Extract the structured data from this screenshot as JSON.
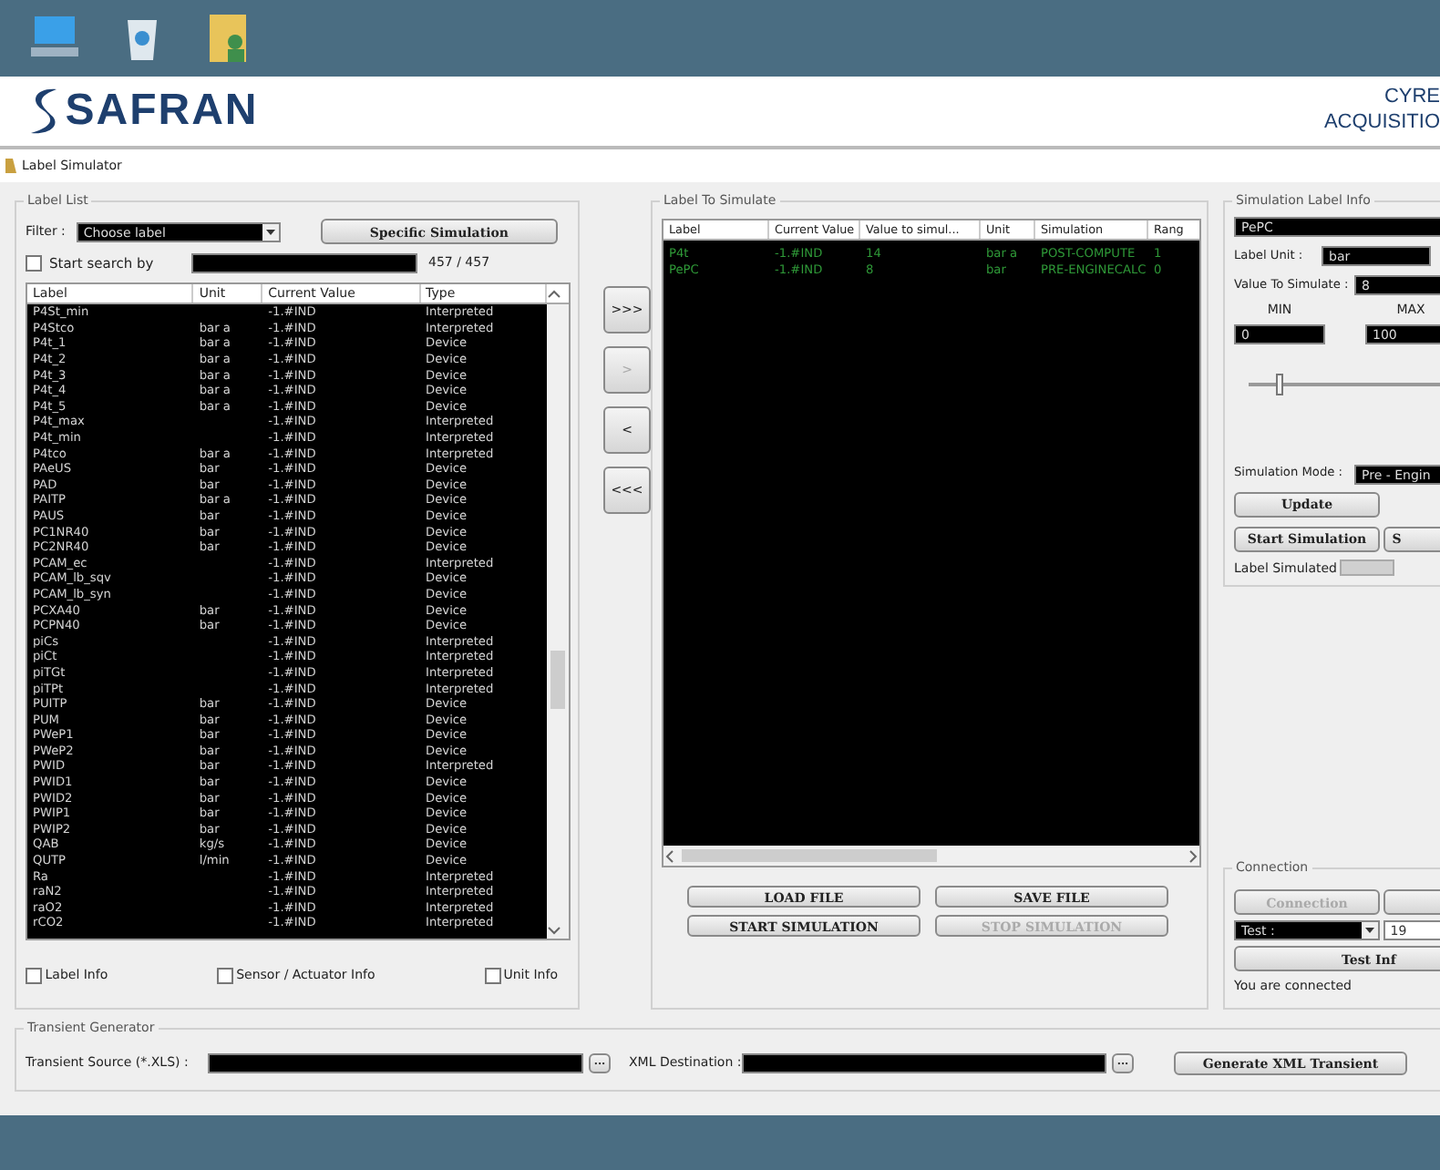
{
  "desktop_icons": [
    {
      "kind": "computer"
    },
    {
      "kind": "recycle-bin"
    },
    {
      "kind": "folder"
    }
  ],
  "header": {
    "logo": "SAFRAN",
    "right_text": [
      "CYRE",
      "ACQUISITIO"
    ]
  },
  "window": {
    "title": "Label Simulator"
  },
  "label_list": {
    "title": "Label List",
    "filter_label": "Filter :",
    "filter_value": "Choose label",
    "specific_button": "Specific Simulation",
    "search": {
      "label": "Start search by",
      "checked": false
    },
    "count": "457 / 457",
    "columns": [
      "Label",
      "Unit",
      "Current Value",
      "Type"
    ],
    "rows": [
      [
        "P4St_min",
        "",
        "-1.#IND",
        "Interpreted"
      ],
      [
        "P4Stco",
        "bar a",
        "-1.#IND",
        "Interpreted"
      ],
      [
        "P4t_1",
        "bar a",
        "-1.#IND",
        "Device"
      ],
      [
        "P4t_2",
        "bar a",
        "-1.#IND",
        "Device"
      ],
      [
        "P4t_3",
        "bar a",
        "-1.#IND",
        "Device"
      ],
      [
        "P4t_4",
        "bar a",
        "-1.#IND",
        "Device"
      ],
      [
        "P4t_5",
        "bar a",
        "-1.#IND",
        "Device"
      ],
      [
        "P4t_max",
        "",
        "-1.#IND",
        "Interpreted"
      ],
      [
        "P4t_min",
        "",
        "-1.#IND",
        "Interpreted"
      ],
      [
        "P4tco",
        "bar a",
        "-1.#IND",
        "Interpreted"
      ],
      [
        "PAeUS",
        "bar",
        "-1.#IND",
        "Device"
      ],
      [
        "PAD",
        "bar",
        "-1.#IND",
        "Device"
      ],
      [
        "PAITP",
        "bar a",
        "-1.#IND",
        "Device"
      ],
      [
        "PAUS",
        "bar",
        "-1.#IND",
        "Device"
      ],
      [
        "PC1NR40",
        "bar",
        "-1.#IND",
        "Device"
      ],
      [
        "PC2NR40",
        "bar",
        "-1.#IND",
        "Device"
      ],
      [
        "PCAM_ec",
        "",
        "-1.#IND",
        "Interpreted"
      ],
      [
        "PCAM_lb_sqv",
        "",
        "-1.#IND",
        "Device"
      ],
      [
        "PCAM_lb_syn",
        "",
        "-1.#IND",
        "Device"
      ],
      [
        "PCXA40",
        "bar",
        "-1.#IND",
        "Device"
      ],
      [
        "PCPN40",
        "bar",
        "-1.#IND",
        "Device"
      ],
      [
        "piCs",
        "",
        "-1.#IND",
        "Interpreted"
      ],
      [
        "piCt",
        "",
        "-1.#IND",
        "Interpreted"
      ],
      [
        "piTGt",
        "",
        "-1.#IND",
        "Interpreted"
      ],
      [
        "piTPt",
        "",
        "-1.#IND",
        "Interpreted"
      ],
      [
        "PUITP",
        "bar",
        "-1.#IND",
        "Device"
      ],
      [
        "PUM",
        "bar",
        "-1.#IND",
        "Device"
      ],
      [
        "PWeP1",
        "bar",
        "-1.#IND",
        "Device"
      ],
      [
        "PWeP2",
        "bar",
        "-1.#IND",
        "Device"
      ],
      [
        "PWID",
        "bar",
        "-1.#IND",
        "Interpreted"
      ],
      [
        "PWID1",
        "bar",
        "-1.#IND",
        "Device"
      ],
      [
        "PWID2",
        "bar",
        "-1.#IND",
        "Device"
      ],
      [
        "PWIP1",
        "bar",
        "-1.#IND",
        "Device"
      ],
      [
        "PWIP2",
        "bar",
        "-1.#IND",
        "Device"
      ],
      [
        "QAB",
        "kg/s",
        "-1.#IND",
        "Device"
      ],
      [
        "QUTP",
        "l/min",
        "-1.#IND",
        "Device"
      ],
      [
        "Ra",
        "",
        "-1.#IND",
        "Interpreted"
      ],
      [
        "raN2",
        "",
        "-1.#IND",
        "Interpreted"
      ],
      [
        "raO2",
        "",
        "-1.#IND",
        "Interpreted"
      ],
      [
        "rCO2",
        "",
        "-1.#IND",
        "Interpreted"
      ]
    ],
    "options": [
      {
        "label": "Label Info",
        "checked": false
      },
      {
        "label": "Sensor / Actuator Info",
        "checked": false
      },
      {
        "label": "Unit Info",
        "checked": false
      }
    ]
  },
  "transfer_buttons": [
    {
      "label": ">>>",
      "disabled": false
    },
    {
      "label": ">",
      "disabled": true
    },
    {
      "label": "<",
      "disabled": false
    },
    {
      "label": "<<<",
      "disabled": false
    }
  ],
  "label_to_simulate": {
    "title": "Label To Simulate",
    "columns": [
      "Label",
      "Current Value",
      "Value to simul...",
      "Unit",
      "Simulation",
      "Rang"
    ],
    "rows": [
      [
        "P4t",
        "-1.#IND",
        "14",
        "bar a",
        "POST-COMPUTE",
        "1"
      ],
      [
        "PePC",
        "-1.#IND",
        "8",
        "bar",
        "PRE-ENGINECALC",
        "0"
      ]
    ],
    "buttons": [
      {
        "label": "LOAD FILE",
        "disabled": false
      },
      {
        "label": "SAVE FILE",
        "disabled": false
      },
      {
        "label": "START SIMULATION",
        "disabled": false
      },
      {
        "label": "STOP SIMULATION",
        "disabled": true
      }
    ]
  },
  "simulation_label_info": {
    "title": "Simulation Label Info",
    "name": "PePC",
    "unit_label": "Label Unit :",
    "unit": "bar",
    "value_label": "Value To Simulate :",
    "value": "8",
    "min_label": "MIN",
    "min": "0",
    "max_label": "MAX",
    "max": "100",
    "slider": {
      "level": 0.12
    },
    "mode_label": "Simulation Mode :",
    "mode": "Pre - Engin",
    "update_button": "Update",
    "start_button": "Start Simulation",
    "third_button": "S",
    "simulated_label": "Label Simulated"
  },
  "connection": {
    "title": "Connection",
    "connect_button": {
      "label": "Connection",
      "disabled": true
    },
    "test_label": "Test :",
    "test_value": "19",
    "test_info_button": "Test Inf",
    "status": "You are connected"
  },
  "transient_generator": {
    "title": "Transient Generator",
    "source_label": "Transient Source (*.XLS) :",
    "browse": "...",
    "destination_label": "XML Destination :",
    "browse2": "...",
    "generate_button": "Generate XML Transient"
  }
}
